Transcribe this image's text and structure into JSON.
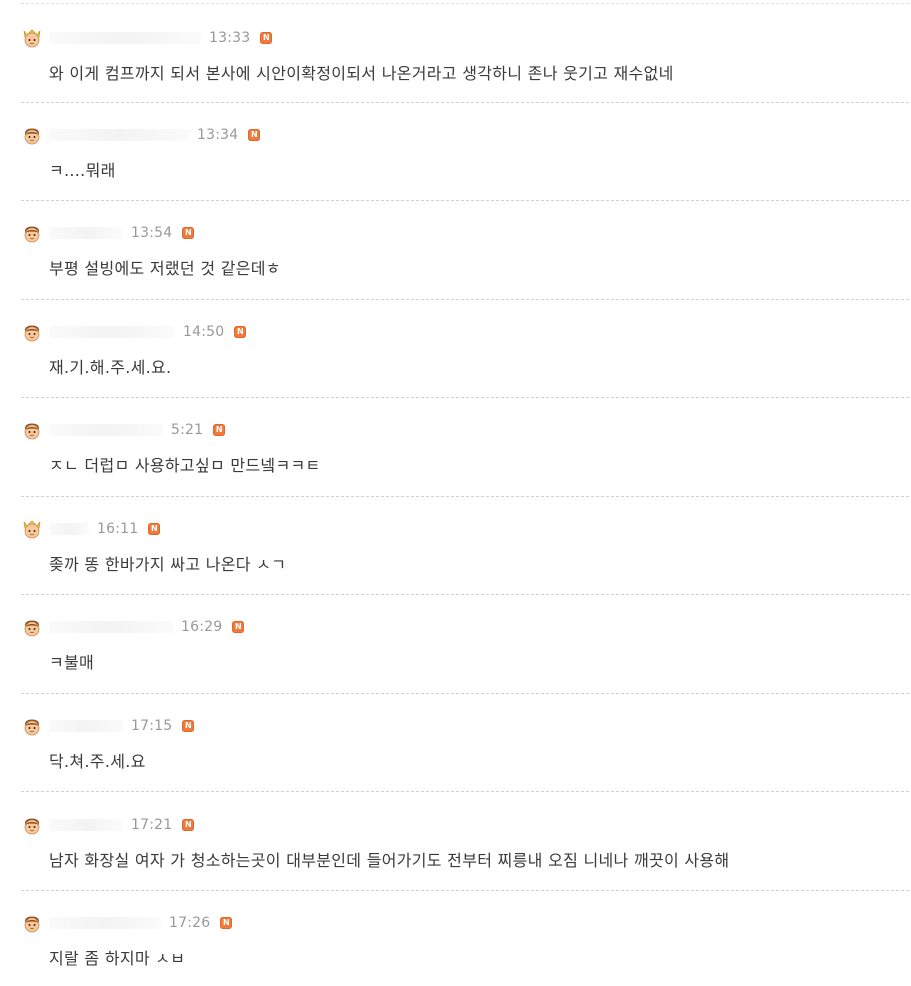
{
  "comments": [
    {
      "avatar": "crown-avatar-icon",
      "time": "13:33",
      "badge": "N",
      "text": "와 이게 컴프까지 되서 본사에 시안이확정이되서 나온거라고 생각하니 존나 웃기고 재수없네"
    },
    {
      "avatar": "user-avatar-icon",
      "time": "13:34",
      "badge": "N",
      "text": "ㅋ....뭐래"
    },
    {
      "avatar": "user-avatar-icon",
      "time": "13:54",
      "badge": "N",
      "text": "부평 설빙에도 저랬던 것 같은데ㅎ"
    },
    {
      "avatar": "user-avatar-icon",
      "time": "14:50",
      "badge": "N",
      "text": "재.기.해.주.세.요."
    },
    {
      "avatar": "user-avatar-icon",
      "time": "5:21",
      "badge": "N",
      "text": "ㅈㄴ 더럽ㅁ 사용하고싶ㅁ 만드넼ㅋㅋㅌ"
    },
    {
      "avatar": "crown-avatar-icon",
      "time": "16:11",
      "badge": "N",
      "text": "좆까 똥 한바가지 싸고 나온다 ㅅㄱ"
    },
    {
      "avatar": "user-avatar-icon",
      "time": "16:29",
      "badge": "N",
      "text": "ㅋ불매"
    },
    {
      "avatar": "user-avatar-icon",
      "time": "17:15",
      "badge": "N",
      "text": "닥.쳐.주.세.요"
    },
    {
      "avatar": "user-avatar-icon",
      "time": "17:21",
      "badge": "N",
      "text": "남자 화장실 여자 가 청소하는곳이 대부분인데 들어가기도 전부터 찌릉내 오짐 니네나 깨끗이 사용해"
    },
    {
      "avatar": "user-avatar-icon",
      "time": "17:26",
      "badge": "N",
      "text": "지랄 좀 하지마 ㅅㅂ"
    }
  ]
}
